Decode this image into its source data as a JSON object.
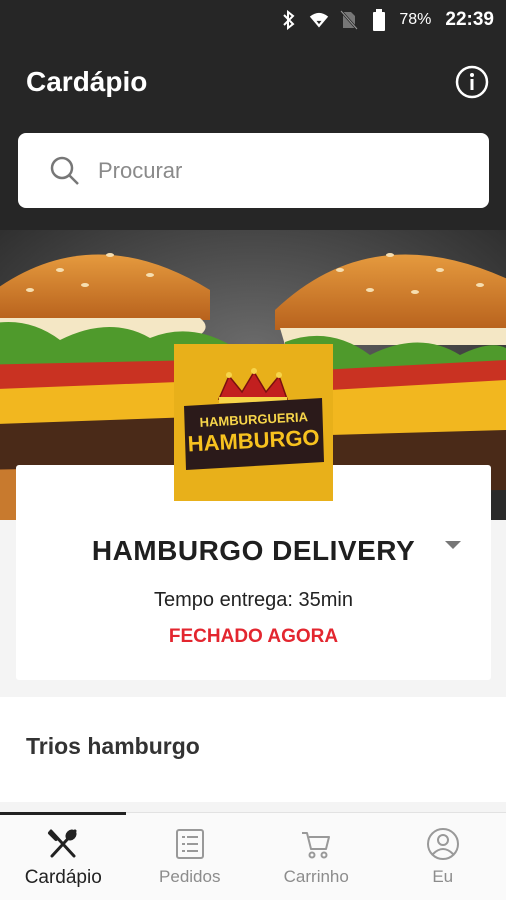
{
  "status_bar": {
    "battery": "78%",
    "time": "22:39"
  },
  "app_bar": {
    "title": "Cardápio"
  },
  "search": {
    "placeholder": "Procurar"
  },
  "logo": {
    "line1": "HAMBURGUERIA",
    "line2": "HAMBURGO"
  },
  "store": {
    "name": "HAMBURGO DELIVERY",
    "delivery_time": "Tempo entrega: 35min",
    "status": "FECHADO AGORA"
  },
  "category": {
    "title": "Trios hamburgo"
  },
  "bottom_nav": {
    "items": [
      {
        "label": "Cardápio",
        "icon": "fork-knife-icon",
        "active": true
      },
      {
        "label": "Pedidos",
        "icon": "list-icon",
        "active": false
      },
      {
        "label": "Carrinho",
        "icon": "cart-icon",
        "active": false
      },
      {
        "label": "Eu",
        "icon": "user-icon",
        "active": false
      }
    ]
  },
  "colors": {
    "header": "#262626",
    "status_closed": "#e3262f",
    "logo_background": "#e8b01a"
  }
}
